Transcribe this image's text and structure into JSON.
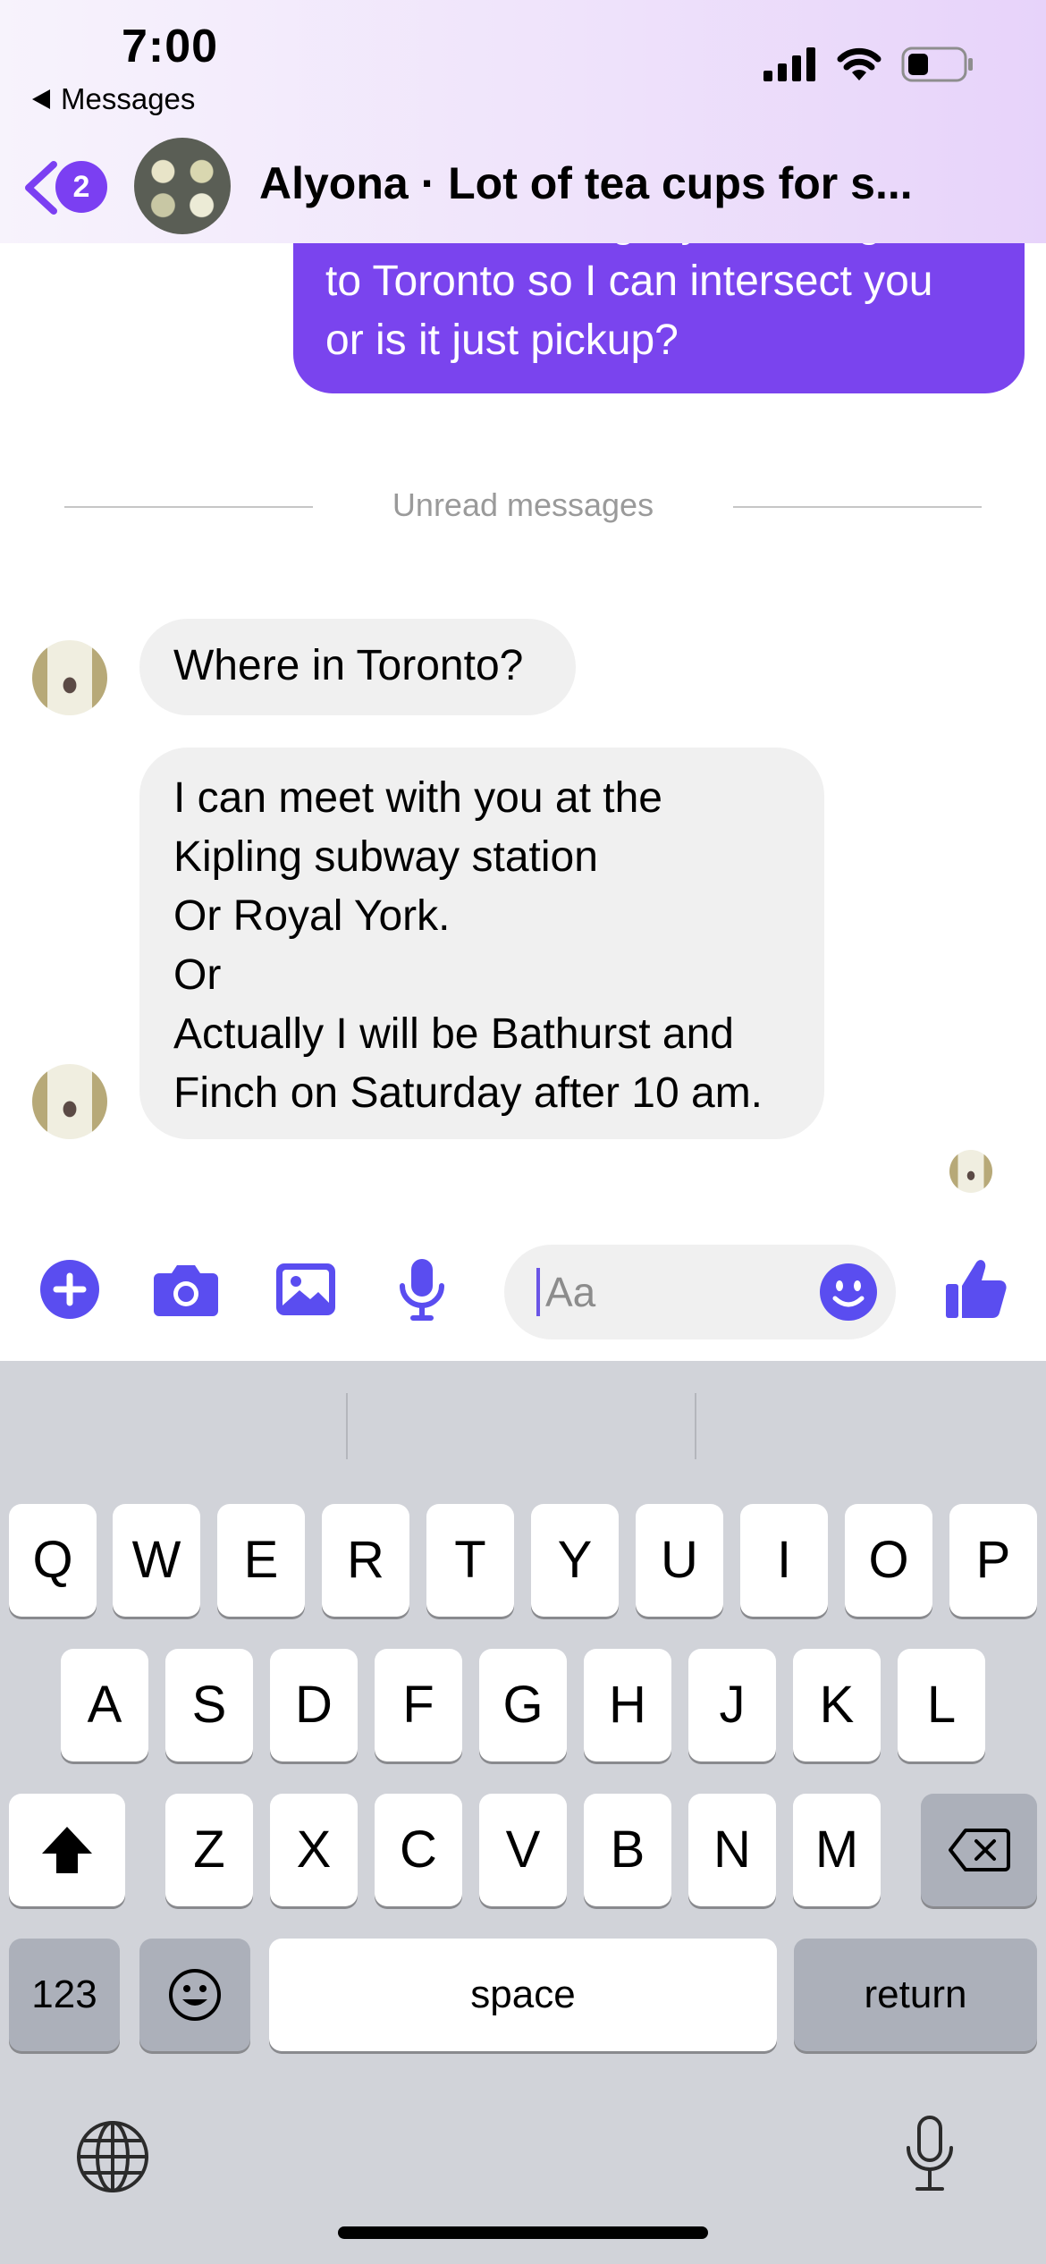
{
  "status_bar": {
    "time": "7:00",
    "back_app_label": "Messages"
  },
  "header": {
    "unread_count": "2",
    "thread_title": "Alyona · Lot of tea cups for s..."
  },
  "messages": {
    "outgoing_partial_line": "I was wondering if you ever go",
    "outgoing_lines": [
      "to Toronto so I can intersect you",
      "or is it just pickup?"
    ],
    "unread_divider": "Unread messages",
    "incoming_1": "Where in Toronto?",
    "incoming_2_lines": [
      "I can meet with you at the",
      "Kipling subway station",
      "Or Royal York.",
      "Or",
      "Actually I will be Bathurst and",
      "Finch on Saturday after 10 am."
    ]
  },
  "composer": {
    "placeholder": "Aa"
  },
  "keyboard": {
    "row1": [
      "Q",
      "W",
      "E",
      "R",
      "T",
      "Y",
      "U",
      "I",
      "O",
      "P"
    ],
    "row2": [
      "A",
      "S",
      "D",
      "F",
      "G",
      "H",
      "J",
      "K",
      "L"
    ],
    "row3": [
      "Z",
      "X",
      "C",
      "V",
      "B",
      "N",
      "M"
    ],
    "numbers_key": "123",
    "space_key": "space",
    "return_key": "return"
  },
  "colors": {
    "accent": "#7a44ee",
    "icon_blue": "#5a4df0",
    "bubble_in": "#f0f0f0",
    "keyboard_bg": "#d1d3d9"
  },
  "icons": [
    "back-chevron-icon",
    "signal-icon",
    "wifi-icon",
    "battery-icon",
    "plus-icon",
    "camera-icon",
    "gallery-icon",
    "microphone-icon",
    "emoji-icon",
    "thumbs-up-icon",
    "shift-icon",
    "delete-icon",
    "globe-icon",
    "dictation-icon"
  ]
}
